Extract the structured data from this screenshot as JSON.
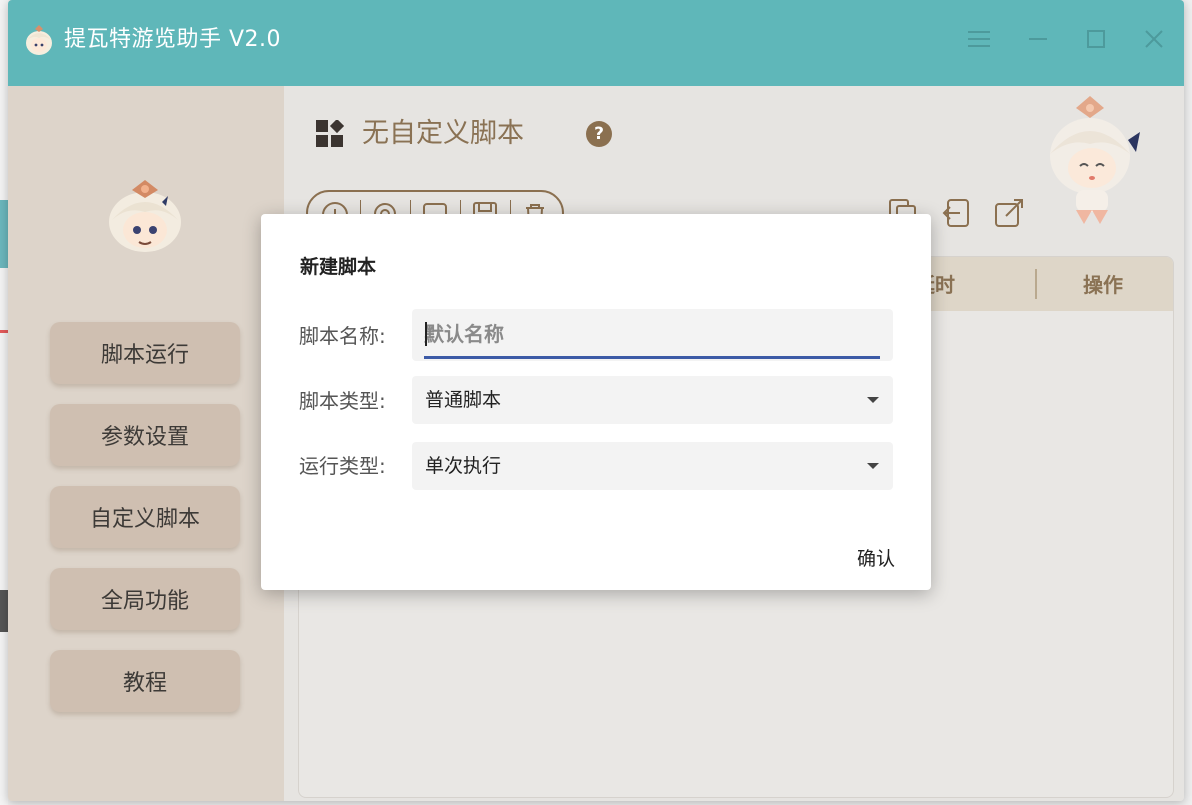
{
  "window": {
    "title": "提瓦特游览助手 V2.0",
    "colors": {
      "titlebar": "#5fb7b9",
      "sidebar": "#ddd4ca",
      "nav_button": "#cfbfb1",
      "accent_brown": "#8b7050"
    }
  },
  "sidebar": {
    "items": [
      {
        "label": "脚本运行"
      },
      {
        "label": "参数设置"
      },
      {
        "label": "自定义脚本"
      },
      {
        "label": "全局功能"
      },
      {
        "label": "教程"
      }
    ]
  },
  "main": {
    "page_title": "无自定义脚本",
    "help_symbol": "?",
    "toolbar_icons": [
      "add-icon",
      "search-icon",
      "edit-icon",
      "save-icon",
      "delete-icon"
    ],
    "right_icons": [
      "copy-icon",
      "import-icon",
      "export-icon"
    ],
    "table": {
      "headers": {
        "delay": "延时",
        "actions": "操作"
      }
    }
  },
  "dialog": {
    "title": "新建脚本",
    "name_label": "脚本名称:",
    "name_value": "",
    "name_placeholder": "默认名称",
    "script_type_label": "脚本类型:",
    "script_type_value": "普通脚本",
    "run_type_label": "运行类型:",
    "run_type_value": "单次执行",
    "confirm_label": "确认"
  }
}
